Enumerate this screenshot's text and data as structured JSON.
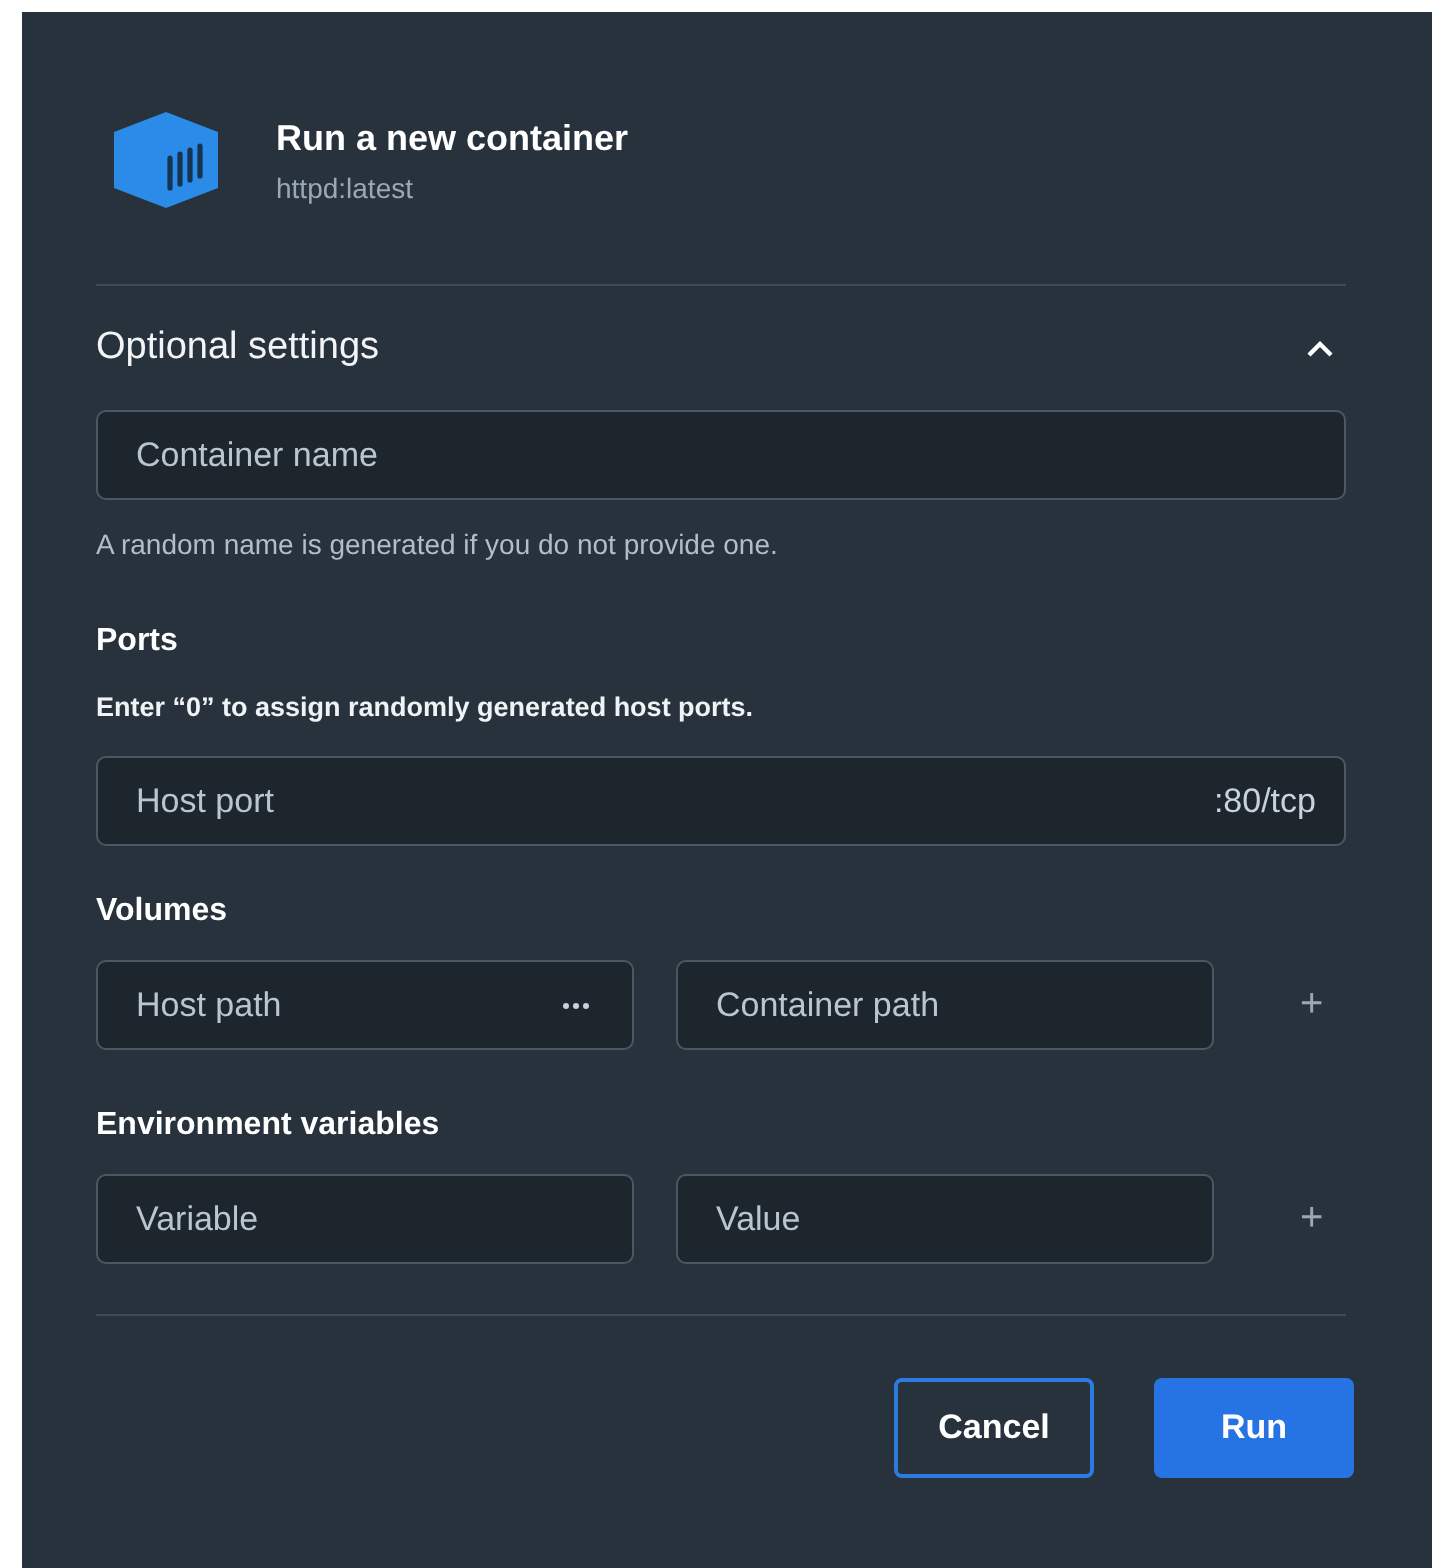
{
  "dialog": {
    "title": "Run a new container",
    "subtitle": "httpd:latest"
  },
  "section": {
    "title": "Optional settings",
    "expanded": true
  },
  "container_name": {
    "placeholder": "Container name",
    "hint": "A random name is generated if you do not provide one."
  },
  "ports": {
    "title": "Ports",
    "hint": "Enter “0” to assign randomly generated host ports.",
    "fields": [
      {
        "placeholder": "Host port",
        "suffix": ":80/tcp"
      }
    ]
  },
  "volumes": {
    "title": "Volumes",
    "host": {
      "placeholder": "Host path",
      "browse": true
    },
    "container": {
      "placeholder": "Container path"
    },
    "add": "+"
  },
  "environment": {
    "title": "Environment variables",
    "variable": {
      "placeholder": "Variable"
    },
    "value": {
      "placeholder": "Value"
    },
    "add": "+"
  },
  "buttons": [
    {
      "label": "Cancel",
      "kind": "secondary"
    },
    {
      "label": "Run",
      "kind": "primary"
    }
  ]
}
